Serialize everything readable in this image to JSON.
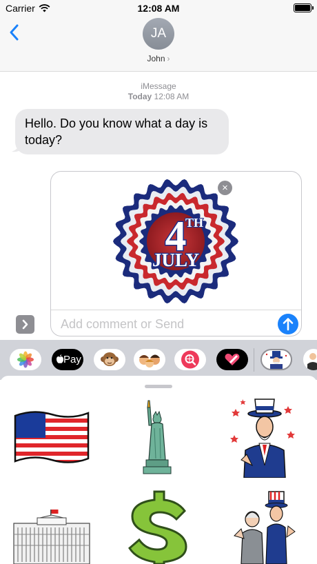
{
  "status_bar": {
    "carrier": "Carrier",
    "time": "12:08 AM"
  },
  "header": {
    "avatar_initials": "JA",
    "contact_name": "John",
    "contact_chevron": "›"
  },
  "conversation": {
    "service": "iMessage",
    "day": "Today",
    "time": "12:08 AM",
    "messages": [
      {
        "from": "John",
        "text": "Hello. Do you know what a day is today?"
      }
    ]
  },
  "compose": {
    "sticker": {
      "name": "4th of july rosette",
      "line1": "4",
      "superscript": "TH",
      "line2": "JULY"
    },
    "remove_icon": "×",
    "placeholder": "Add comment or Send"
  },
  "app_drawer": {
    "apps": [
      "photos",
      "apple-pay",
      "monkey-memoji",
      "memoji-group",
      "search-images",
      "stickers-heart",
      "uncle-sam-stickers",
      "more"
    ],
    "apple_pay_label": "Pay",
    "apple_pay_logo": ""
  },
  "sticker_panel": {
    "stickers": [
      "american-flag",
      "statue-of-liberty",
      "uncle-sam",
      "white-house",
      "dollar-sign",
      "founding-father-with-uncle-sam"
    ]
  },
  "colors": {
    "accent": "#1a82fb",
    "bubble": "#e9e9eb",
    "drawer": "#d1d3d9"
  }
}
